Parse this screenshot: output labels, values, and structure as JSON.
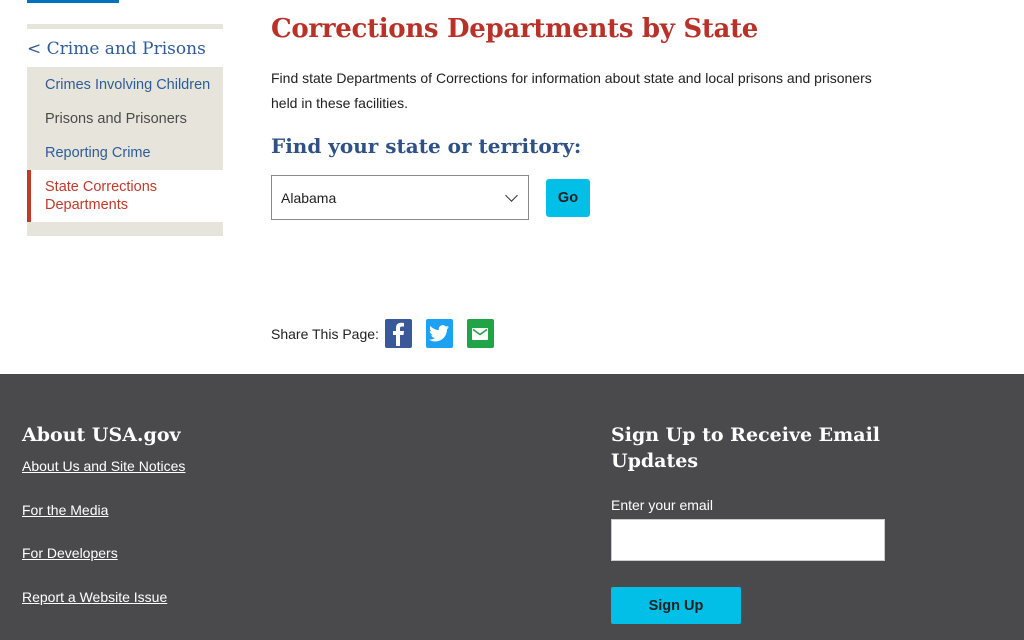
{
  "sidebar": {
    "back_label": "< Crime and Prisons",
    "items": [
      {
        "label": "Crimes Involving Children",
        "state": "link"
      },
      {
        "label": "Prisons and Prisoners",
        "state": "muted"
      },
      {
        "label": "Reporting Crime",
        "state": "link"
      },
      {
        "label": "State Corrections Departments",
        "state": "active"
      }
    ]
  },
  "main": {
    "title": "Corrections Departments by State",
    "intro": "Find state Departments of Corrections for information about state and local prisons and prisoners held in these facilities.",
    "find_heading": "Find your state or territory:",
    "select": {
      "selected_value": "Alabama",
      "icon": "chevron-down-icon"
    },
    "go_label": "Go"
  },
  "share": {
    "label": "Share This Page:",
    "icons": [
      "facebook-icon",
      "twitter-icon",
      "email-icon"
    ],
    "colors": {
      "facebook": "#3b5998",
      "twitter": "#1da1f2",
      "email": "#20a447"
    }
  },
  "footer": {
    "about_heading": "About USA.gov",
    "links": [
      "About Us and Site Notices",
      "For the Media",
      "For Developers",
      "Report a Website Issue"
    ],
    "signup_heading": "Sign Up to Receive Email Updates",
    "email_label": "Enter your email",
    "email_value": "",
    "signup_label": "Sign Up"
  },
  "colors": {
    "title_red": "#b9322a",
    "heading_blue": "#2e5186",
    "link_blue": "#2e5c97",
    "button_cyan": "#02bfe7",
    "footer_bg": "#4a4a4c"
  }
}
